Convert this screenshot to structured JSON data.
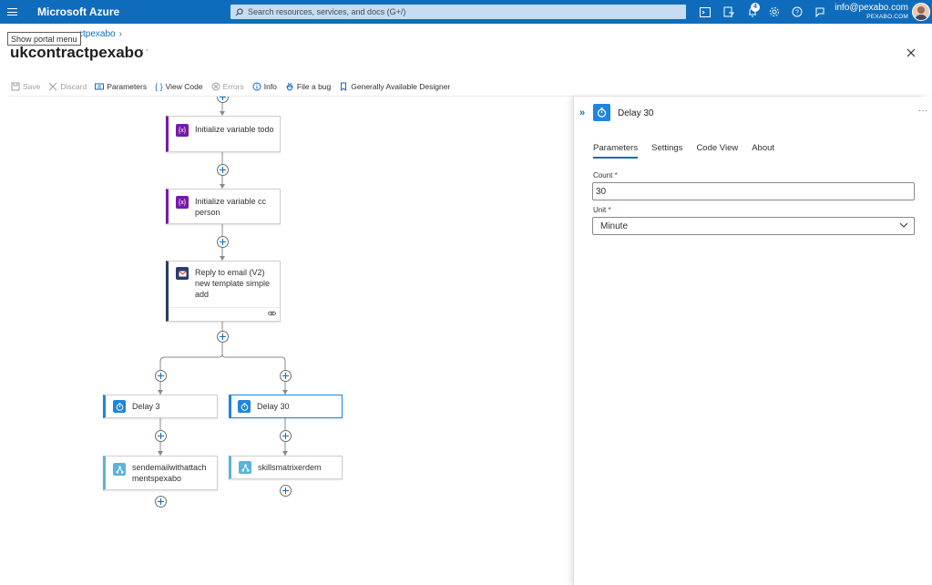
{
  "topbar": {
    "brand": "Microsoft Azure",
    "search_placeholder": "Search resources, services, and docs (G+/)",
    "notification_count": "4",
    "account_email": "info@pexabo.com",
    "account_org": "PEXABO.COM",
    "accent": "#0f6cbd"
  },
  "header": {
    "tooltip": "Show portal menu",
    "breadcrumb": "ctpexabo",
    "title": "ukcontractpexabo",
    "more": "···"
  },
  "toolbar": {
    "save": "Save",
    "discard": "Discard",
    "parameters": "Parameters",
    "view_code": "View Code",
    "errors": "Errors",
    "info": "Info",
    "file_bug": "File a bug",
    "designer": "Generally Available Designer"
  },
  "canvas": {
    "init_todo": "Initialize variable todo",
    "init_cc": "Initialize variable cc person",
    "reply_email": "Reply to email (V2) new template simple add",
    "delay3": "Delay 3",
    "delay30": "Delay 30",
    "workflow_left": "sendemailwithattachmentspexabo",
    "workflow_right": "skillsmatrixerdem"
  },
  "panel": {
    "title": "Delay 30",
    "more": "···",
    "tabs": [
      "Parameters",
      "Settings",
      "Code View",
      "About"
    ],
    "active_tab": "Parameters",
    "count_label": "Count",
    "count_value": "30",
    "unit_label": "Unit",
    "unit_value": "Minute",
    "required_marker": "*"
  }
}
